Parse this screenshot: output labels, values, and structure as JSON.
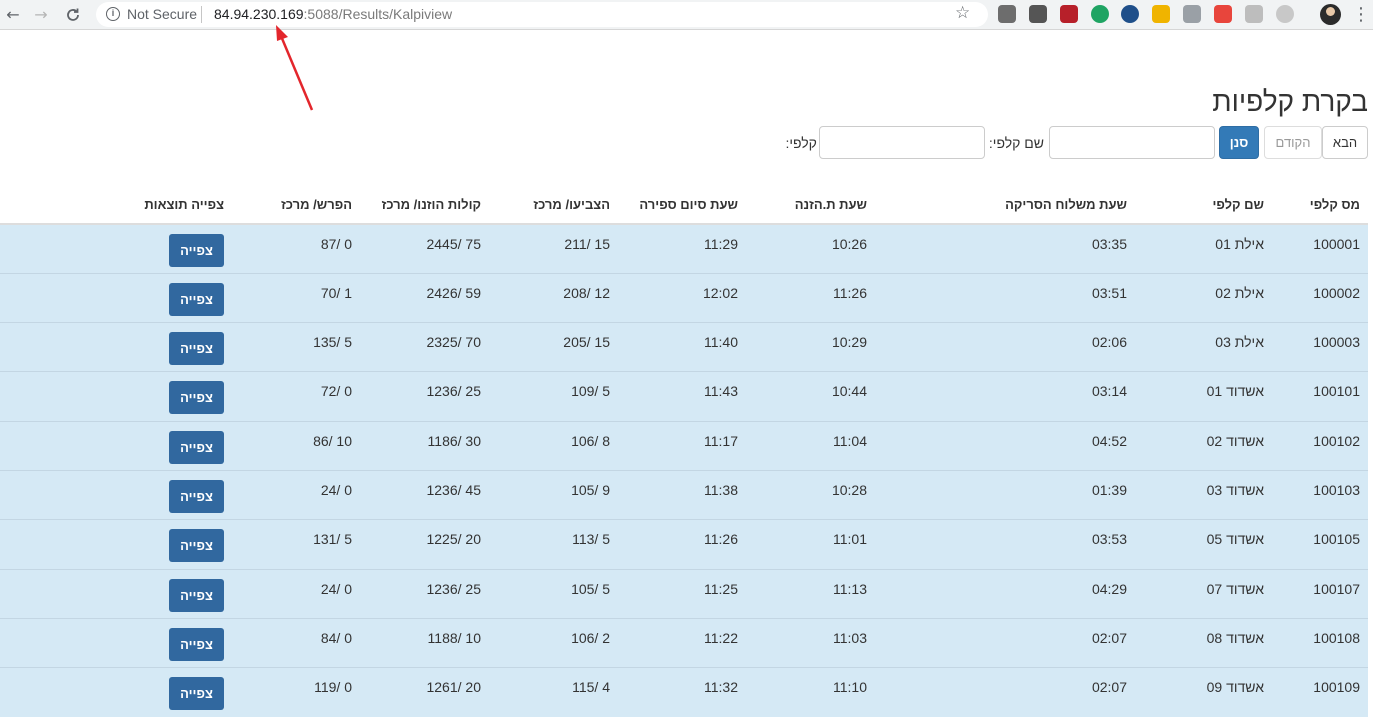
{
  "browser": {
    "security_label": "Not Secure",
    "url_host": "84.94.230.169",
    "url_rest": ":5088/Results/Kalpiview",
    "back_icon": "←",
    "forward_icon": "→",
    "reload_icon": "C",
    "star_icon": "☆",
    "menu_icon": "⋮",
    "extension_colors": [
      "#6d6d6d",
      "#555555",
      "#b7202a",
      "#1fa463",
      "#1f4f8a",
      "#f0b400",
      "#9aa0a6",
      "#e8453c",
      "#bdbdbd",
      "#c8c8c8"
    ]
  },
  "page": {
    "title": "בקרת קלפיות"
  },
  "search": {
    "kalpi_label": "קלפי:",
    "kalpi_name_label": "שם קלפי:",
    "filter_button": "סנן",
    "prev_button": "הקודם",
    "next_button": "הבא"
  },
  "table": {
    "headers": [
      "מס קלפי",
      "שם קלפי",
      "שעת משלוח הסריקה",
      "שעת ת.הזנה",
      "שעת סיום ספירה",
      "הצביעו/ מרכז",
      "קולות הוזנו/ מרכז",
      "הפרש/ מרכז",
      "צפייה תוצאות"
    ],
    "view_button_label": "צפייה",
    "rows": [
      [
        "100001",
        "אילת 01",
        "03:35",
        "10:26",
        "11:29",
        "15 /211",
        "75 /2445",
        "0 /87"
      ],
      [
        "100002",
        "אילת 02",
        "03:51",
        "11:26",
        "12:02",
        "12 /208",
        "59 /2426",
        "1 /70"
      ],
      [
        "100003",
        "אילת 03",
        "02:06",
        "10:29",
        "11:40",
        "15 /205",
        "70 /2325",
        "5 /135"
      ],
      [
        "100101",
        "אשדוד 01",
        "03:14",
        "10:44",
        "11:43",
        "5 /109",
        "25 /1236",
        "0 /72"
      ],
      [
        "100102",
        "אשדוד 02",
        "04:52",
        "11:04",
        "11:17",
        "8 /106",
        "30 /1186",
        "10 /86"
      ],
      [
        "100103",
        "אשדוד 03",
        "01:39",
        "10:28",
        "11:38",
        "9 /105",
        "45 /1236",
        "0 /24"
      ],
      [
        "100105",
        "אשדוד 05",
        "03:53",
        "11:01",
        "11:26",
        "5 /113",
        "20 /1225",
        "5 /131"
      ],
      [
        "100107",
        "אשדוד 07",
        "04:29",
        "11:13",
        "11:25",
        "5 /105",
        "25 /1236",
        "0 /24"
      ],
      [
        "100108",
        "אשדוד 08",
        "02:07",
        "11:03",
        "11:22",
        "2 /106",
        "10 /1188",
        "0 /84"
      ],
      [
        "100109",
        "אשדוד 09",
        "02:07",
        "11:10",
        "11:32",
        "4 /115",
        "20 /1261",
        "0 /119"
      ]
    ]
  },
  "colors": {
    "row_background": "#d5e9f5",
    "primary_button": "#337ab7",
    "view_button": "#31689f",
    "annotation_arrow": "#e3262c"
  }
}
